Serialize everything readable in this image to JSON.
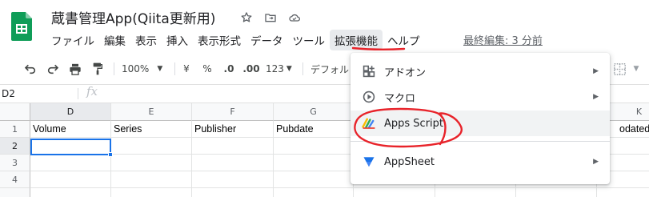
{
  "app": {
    "title": "蔵書管理App(Qiita更新用)",
    "last_edit": "最終編集: 3 分前"
  },
  "menubar": [
    {
      "label": "ファイル"
    },
    {
      "label": "編集"
    },
    {
      "label": "表示"
    },
    {
      "label": "挿入"
    },
    {
      "label": "表示形式"
    },
    {
      "label": "データ"
    },
    {
      "label": "ツール"
    },
    {
      "label": "拡張機能",
      "active": true
    },
    {
      "label": "ヘルプ"
    }
  ],
  "toolbar": {
    "zoom": "100%",
    "currency": "¥",
    "percent": "%",
    "dec_less": ".0",
    "dec_more": ".00",
    "format_more": "123",
    "font": "デフォル"
  },
  "formula_bar": {
    "name_box": "D2",
    "fx": "fx"
  },
  "grid": {
    "columns": [
      "D",
      "E",
      "F",
      "G",
      "K"
    ],
    "rows": [
      "1",
      "2",
      "3",
      "4"
    ],
    "row1": [
      "Volume",
      "Series",
      "Publisher",
      "Pubdate",
      "odated a"
    ],
    "selected_cell": "D2"
  },
  "dropdown": {
    "items": [
      {
        "label": "アドオン",
        "icon": "addon-icon",
        "submenu": true
      },
      {
        "label": "マクロ",
        "icon": "macro-play-icon",
        "submenu": true
      },
      {
        "label": "Apps Script",
        "icon": "apps-script-icon",
        "submenu": false
      },
      {
        "label": "AppSheet",
        "icon": "appsheet-icon",
        "submenu": true
      }
    ]
  },
  "colors": {
    "sheets_green": "#0f9d58",
    "selection_blue": "#1a73e8",
    "annotation_red": "#e8232a",
    "menu_hover": "#f1f3f4"
  }
}
